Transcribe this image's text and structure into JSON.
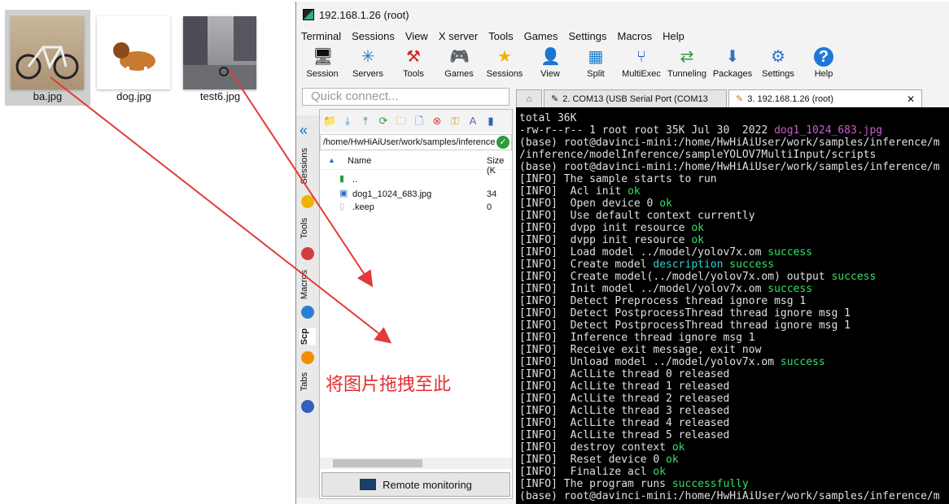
{
  "desktop": {
    "files": [
      {
        "name": "ba.jpg",
        "selected": true
      },
      {
        "name": "dog.jpg",
        "selected": false
      },
      {
        "name": "test6.jpg",
        "selected": false
      }
    ]
  },
  "window": {
    "title": "192.168.1.26 (root)",
    "menu": [
      "Terminal",
      "Sessions",
      "View",
      "X server",
      "Tools",
      "Games",
      "Settings",
      "Macros",
      "Help"
    ],
    "toolbar": [
      {
        "label": "Session",
        "icon": "session-icon"
      },
      {
        "label": "Servers",
        "icon": "servers-icon"
      },
      {
        "label": "Tools",
        "icon": "tools-icon"
      },
      {
        "label": "Games",
        "icon": "games-icon"
      },
      {
        "label": "Sessions",
        "icon": "sessions-star-icon"
      },
      {
        "label": "View",
        "icon": "view-icon"
      },
      {
        "label": "Split",
        "icon": "split-icon"
      },
      {
        "label": "MultiExec",
        "icon": "multiexec-icon"
      },
      {
        "label": "Tunneling",
        "icon": "tunneling-icon"
      },
      {
        "label": "Packages",
        "icon": "packages-icon"
      },
      {
        "label": "Settings",
        "icon": "settings-icon"
      },
      {
        "label": "Help",
        "icon": "help-icon"
      }
    ],
    "quick_connect_placeholder": "Quick connect...",
    "tabs": [
      {
        "label": "2. COM13  (USB Serial Port (COM13",
        "active": false
      },
      {
        "label": "3. 192.168.1.26 (root)",
        "active": true
      }
    ],
    "vertical_tabs": [
      "Sessions",
      "Tools",
      "Macros",
      "Scp",
      "Tabs"
    ],
    "sftp": {
      "path": "/home/HwHiAiUser/work/samples/inference",
      "columns": {
        "name": "Name",
        "size": "Size (K"
      },
      "rows": [
        {
          "name": "..",
          "size": ""
        },
        {
          "name": "dog1_1024_683.jpg",
          "size": "34"
        },
        {
          "name": ".keep",
          "size": "0"
        }
      ],
      "remote_monitoring": "Remote monitoring"
    }
  },
  "terminal": {
    "lines": [
      {
        "t": "total 36K"
      },
      {
        "t": "-rw-r--r-- 1 root root 35K Jul 30  2022 ",
        "hl": "dog1_1024_683.jpg",
        "cls": "m"
      },
      {
        "t": "(base) root@davinci-mini:/home/HwHiAiUser/work/samples/inference/m"
      },
      {
        "t": "/inference/modelInference/sampleYOLOV7MultiInput/scripts"
      },
      {
        "t": "(base) root@davinci-mini:/home/HwHiAiUser/work/samples/inference/m"
      },
      {
        "t": "[INFO] The sample starts to run"
      },
      {
        "t": "[INFO]  Acl init ",
        "hl": "ok",
        "cls": "g"
      },
      {
        "t": "[INFO]  Open device 0 ",
        "hl": "ok",
        "cls": "g"
      },
      {
        "t": "[INFO]  Use default context currently"
      },
      {
        "t": "[INFO]  dvpp init resource ",
        "hl": "ok",
        "cls": "g"
      },
      {
        "t": "[INFO]  dvpp init resource ",
        "hl": "ok",
        "cls": "g"
      },
      {
        "t": "[INFO]  Load model ../model/yolov7x.om ",
        "hl": "success",
        "cls": "g"
      },
      {
        "t": "[INFO]  Create model ",
        "hl": "description",
        "cls": "c",
        "t2": " ",
        "hl2": "success",
        "cls2": "g"
      },
      {
        "t": "[INFO]  Create model(../model/yolov7x.om) output ",
        "hl": "success",
        "cls": "g"
      },
      {
        "t": "[INFO]  Init model ../model/yolov7x.om ",
        "hl": "success",
        "cls": "g"
      },
      {
        "t": "[INFO]  Detect Preprocess thread ignore msg 1"
      },
      {
        "t": "[INFO]  Detect PostprocessThread thread ignore msg 1"
      },
      {
        "t": "[INFO]  Detect PostprocessThread thread ignore msg 1"
      },
      {
        "t": "[INFO]  Inference thread ignore msg 1"
      },
      {
        "t": "[INFO]  Receive exit message, exit now"
      },
      {
        "t": "[INFO]  Unload model ../model/yolov7x.om ",
        "hl": "success",
        "cls": "g"
      },
      {
        "t": "[INFO]  AclLite thread 0 released"
      },
      {
        "t": "[INFO]  AclLite thread 1 released"
      },
      {
        "t": "[INFO]  AclLite thread 2 released"
      },
      {
        "t": "[INFO]  AclLite thread 3 released"
      },
      {
        "t": "[INFO]  AclLite thread 4 released"
      },
      {
        "t": "[INFO]  AclLite thread 5 released"
      },
      {
        "t": "[INFO]  destroy context ",
        "hl": "ok",
        "cls": "g"
      },
      {
        "t": "[INFO]  Reset device 0 ",
        "hl": "ok",
        "cls": "g"
      },
      {
        "t": "[INFO]  Finalize acl ",
        "hl": "ok",
        "cls": "g"
      },
      {
        "t": "[INFO] The program runs ",
        "hl": "successfully",
        "cls": "g"
      },
      {
        "t": "(base) root@davinci-mini:/home/HwHiAiUser/work/samples/inference/m"
      }
    ]
  },
  "annotation": "将图片拖拽至此"
}
